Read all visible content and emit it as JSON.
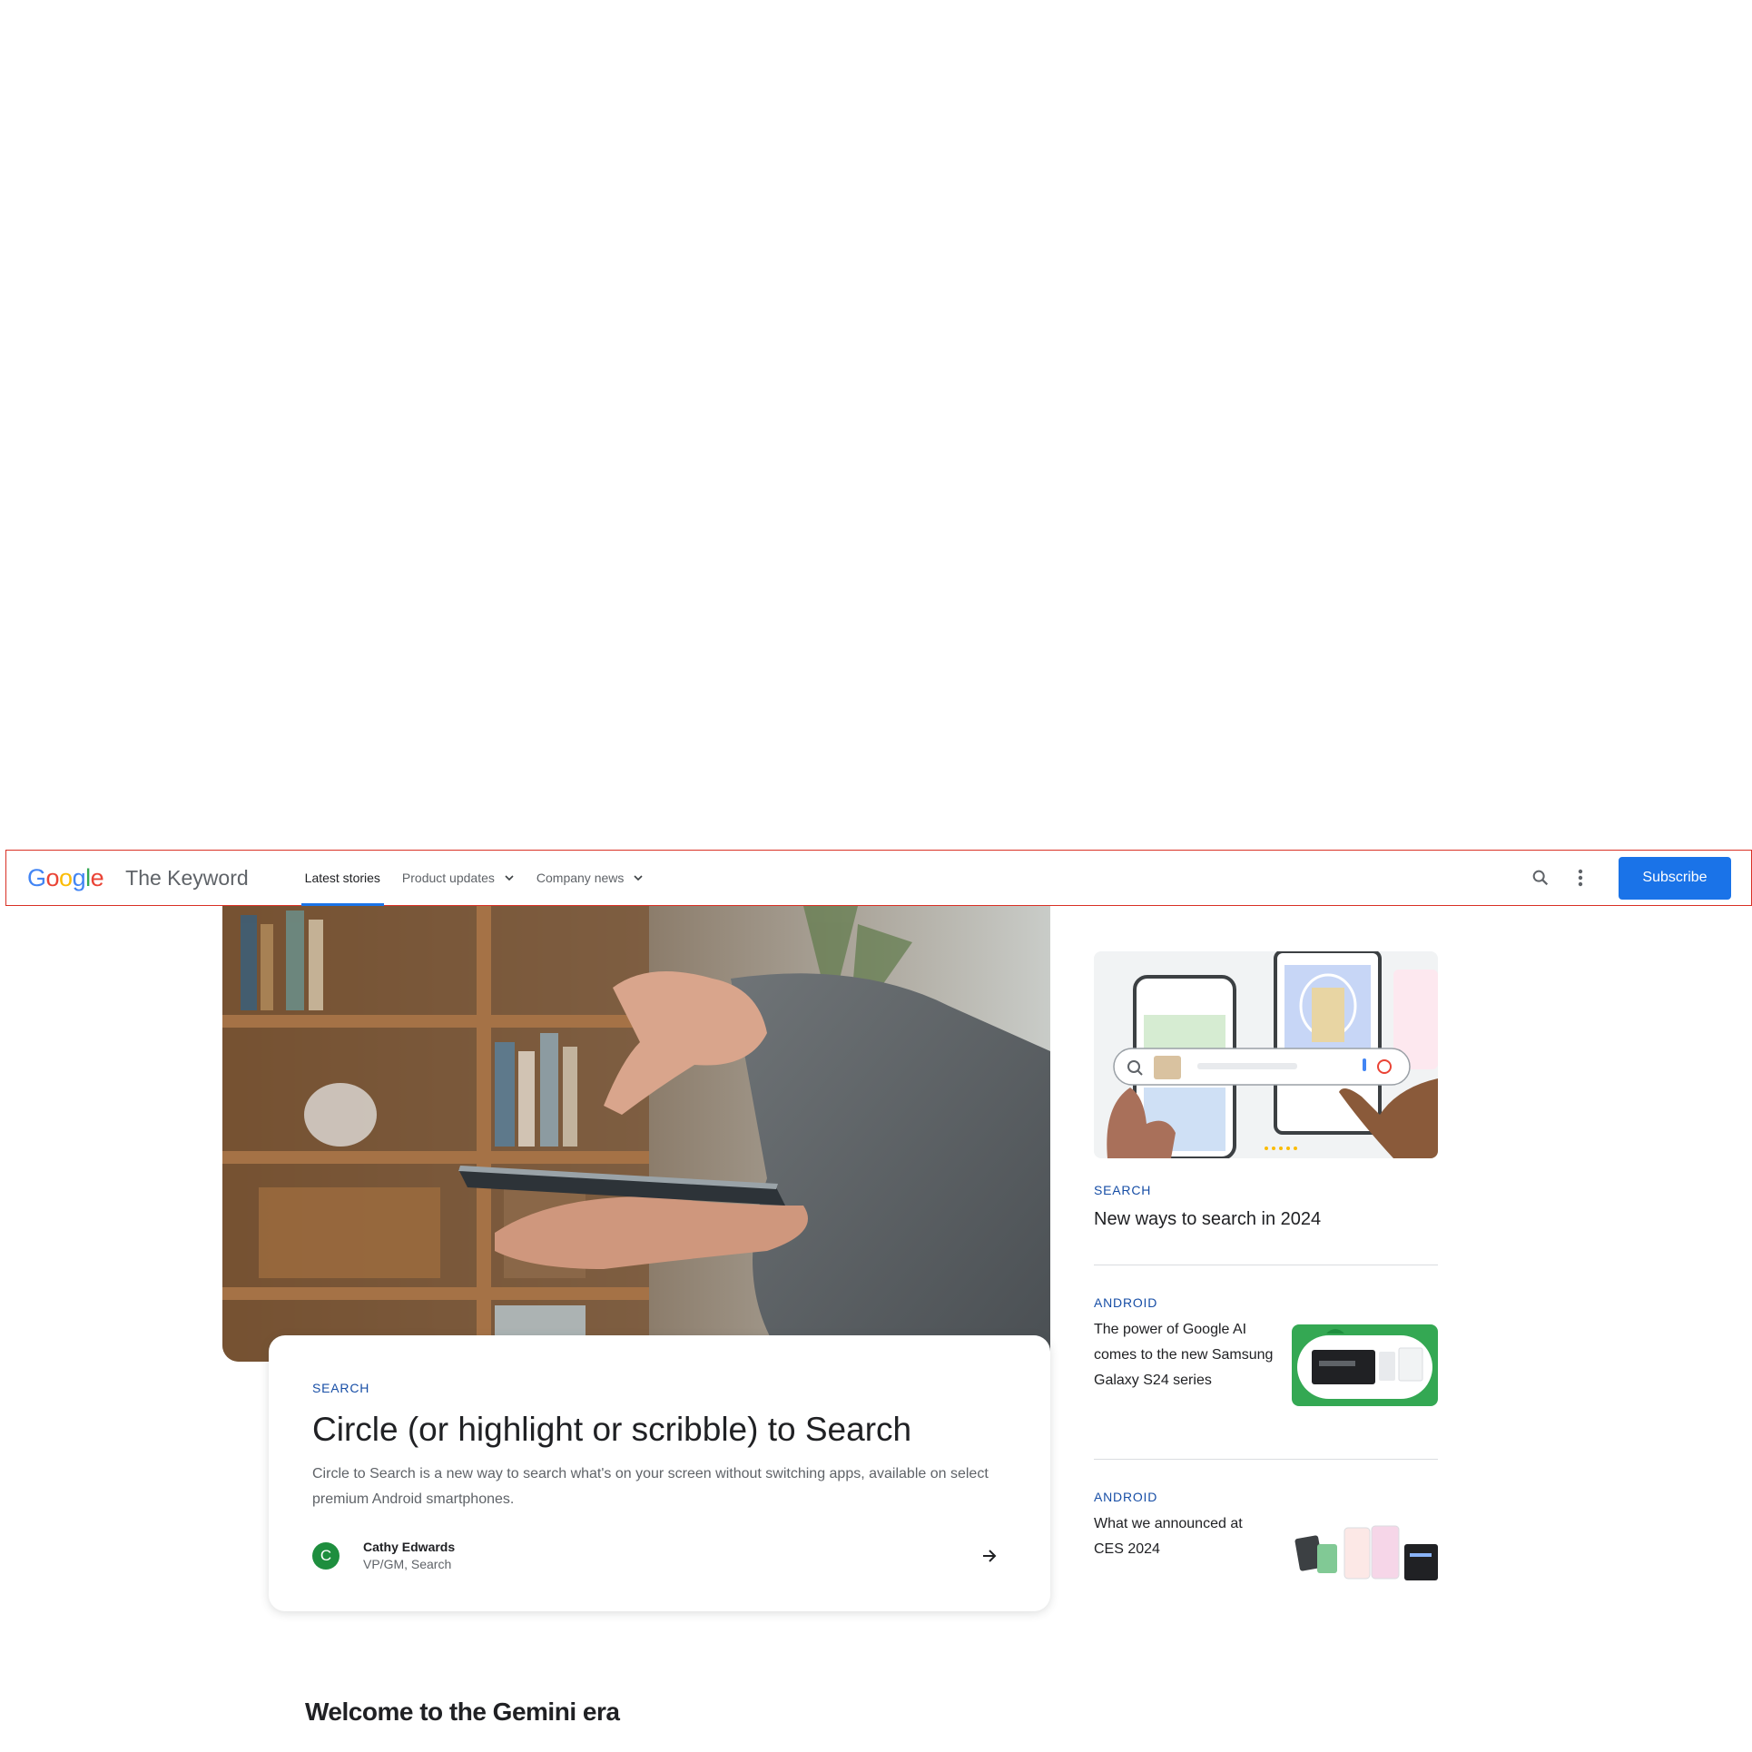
{
  "header": {
    "logo": {
      "letters": [
        "G",
        "o",
        "o",
        "g",
        "l",
        "e"
      ],
      "colors": [
        "#4285f4",
        "#ea4335",
        "#fbbc05",
        "#4285f4",
        "#34a853",
        "#ea4335"
      ]
    },
    "site_title": "The Keyword",
    "nav": [
      {
        "label": "Latest stories",
        "active": true
      },
      {
        "label": "Product updates",
        "dropdown": true
      },
      {
        "label": "Company news",
        "dropdown": true
      }
    ],
    "search_icon": "search-icon",
    "more_icon": "more-vert-icon",
    "subscribe_label": "Subscribe"
  },
  "hero": {
    "eyebrow": "SEARCH",
    "title": "Circle (or highlight or scribble) to Search",
    "description": "Circle to Search is a new way to search what's on your screen without switching apps, available on select premium Android smartphones.",
    "author": {
      "initial": "C",
      "name": "Cathy Edwards",
      "role": "VP/GM, Search"
    },
    "arrow_icon": "arrow-right-icon"
  },
  "side_feature": {
    "eyebrow": "SEARCH",
    "title": "New ways to search in 2024"
  },
  "side_items": [
    {
      "eyebrow": "ANDROID",
      "title": "The power of Google AI comes to the new Samsung Galaxy S24 series"
    },
    {
      "eyebrow": "ANDROID",
      "title": "What we announced at CES 2024"
    }
  ],
  "section": {
    "title": "Welcome to the Gemini era"
  },
  "colors": {
    "accent": "#1a73e8",
    "header_border": "#d93025",
    "avatar_green": "#1e8e3e",
    "thumb_green": "#34a853"
  }
}
